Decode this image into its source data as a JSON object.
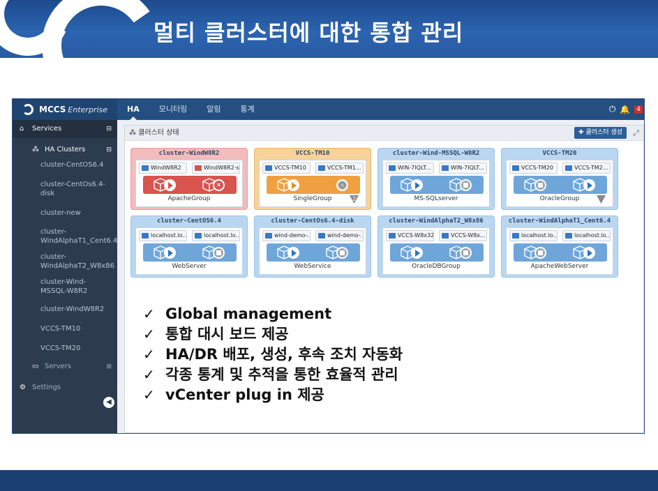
{
  "slide": {
    "title": "멀티 클러스터에 대한 통합 관리"
  },
  "app": {
    "brand_name": "MCCS",
    "brand_sub": "Enterprise",
    "tabs": [
      {
        "label": "HA"
      },
      {
        "label": "모니터링"
      },
      {
        "label": "알림"
      },
      {
        "label": "통계"
      }
    ],
    "notification_count": "4",
    "sidebar": {
      "services_label": "Services",
      "ha_clusters_label": "HA Clusters",
      "clusters": [
        "cluster-CentOS6.4",
        "cluster-CentOs6.4-disk",
        "cluster-new",
        "cluster-WindAlphaT1_Cent6.4",
        "cluster-WindAlphaT2_W8x86",
        "cluster-Wind-MSSQL-W8R2",
        "cluster-WindW8R2",
        "VCCS-TM10",
        "VCCS-TM20"
      ],
      "servers_label": "Servers",
      "settings_label": "Settings"
    },
    "panel": {
      "title": "클러스터 상태",
      "add_button": "클러스터 생성"
    },
    "cards": [
      {
        "title": "cluster-WindW8R2",
        "node1": "WindW8R2",
        "node2": "WindW8R2-s",
        "group": "ApacheGroup",
        "state": "red"
      },
      {
        "title": "VCCS-TM10",
        "node1": "VCCS-TM10",
        "node2": "VCCS-TM1...",
        "group": "SingleGroup",
        "state": "orange",
        "badge": "2"
      },
      {
        "title": "cluster-Wind-MSSQL-W8R2",
        "node1": "WIN-7IQLT...",
        "node2": "WIN-7IQLT...",
        "group": "MS-SQLserver",
        "state": "blue"
      },
      {
        "title": "VCCS-TM20",
        "node1": "VCCS-TM20",
        "node2": "VCCS-TM2...",
        "group": "OracleGroup",
        "state": "blue"
      },
      {
        "title": "cluster-CentOS6.4",
        "node1": "localhost.lo...",
        "node2": "localhost.lo...",
        "group": "WebServer",
        "state": "blue"
      },
      {
        "title": "cluster-CentOs6.4-disk",
        "node1": "wind-demo-...",
        "node2": "wind-demo-...",
        "group": "WebService",
        "state": "blue"
      },
      {
        "title": "cluster-WindAlphaT2_W8x86",
        "node1": "VCCS-W8x32",
        "node2": "VCCS-W8x...",
        "group": "OracleDBGroup",
        "state": "blue"
      },
      {
        "title": "cluster-WindAlphaT1_Cent6.4",
        "node1": "localhost.lo...",
        "node2": "localhost.lo...",
        "group": "ApacheWebServer",
        "state": "blue"
      }
    ]
  },
  "bullets": [
    "Global management",
    "통합 대시 보드 제공",
    "HA/DR 배포, 생성, 후속 조치 자동화",
    "각종 통계 및 추적을 통한 효율적 관리",
    "vCenter plug in 제공"
  ]
}
